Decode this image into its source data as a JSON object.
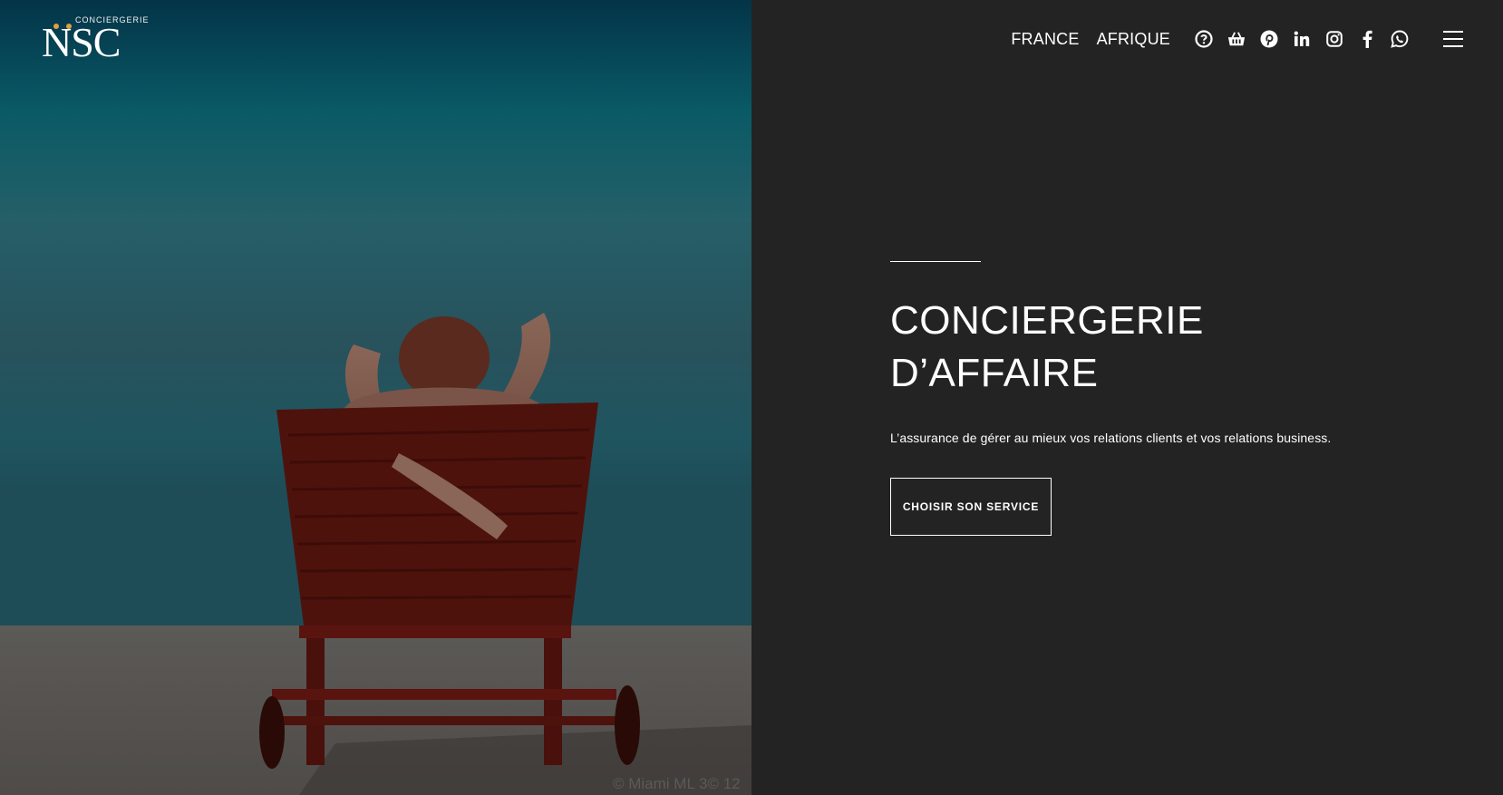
{
  "logo": {
    "subtitle": "CONCIERGERIE",
    "name": "NSC",
    "accent_color": "#e0a040"
  },
  "nav": {
    "links": [
      {
        "label": "FRANCE"
      },
      {
        "label": "AFRIQUE"
      }
    ],
    "icons": [
      "help-icon",
      "shopping-basket-icon",
      "pinterest-icon",
      "linkedin-icon",
      "instagram-icon",
      "facebook-icon",
      "whatsapp-icon"
    ],
    "menu_icon": "hamburger-menu-icon"
  },
  "hero": {
    "title_line1": "CONCIERGERIE",
    "title_line2": "D’AFFAIRE",
    "tagline": "L’assurance de gérer au mieux vos relations clients et vos relations business.",
    "cta_label": "CHOISIR SON SERVICE"
  },
  "photo": {
    "credit": "© Miami ML 3© 12"
  },
  "colors": {
    "background": "#232323",
    "text": "#ffffff"
  }
}
